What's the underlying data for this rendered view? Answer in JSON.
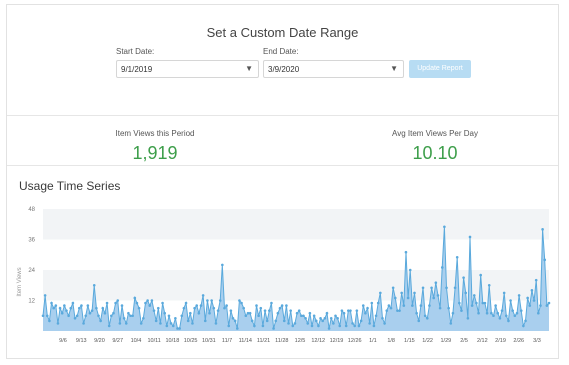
{
  "date_range": {
    "title": "Set a Custom Date Range",
    "start_label": "Start Date:",
    "start_value": "9/1/2019",
    "end_label": "End Date:",
    "end_value": "3/9/2020",
    "update_button": "Update Report",
    "caret_icon": "triangle-down"
  },
  "stats": {
    "views_label": "Item Views this Period",
    "views_value": "1,919",
    "avg_label": "Avg Item Views Per Day",
    "avg_value": "10.10",
    "value_color": "#3d9e4a"
  },
  "usage": {
    "title": "Usage Time Series"
  },
  "chart_data": {
    "type": "area",
    "ylabel": "Item Views",
    "xlabel": "",
    "ylim": [
      0,
      48
    ],
    "yticks": [
      12,
      24,
      36,
      48
    ],
    "grid": "horizontal bands",
    "color": "#5aa9dc",
    "fill": "#a9cfee",
    "xtick_labels": [
      "9/6",
      "9/13",
      "9/20",
      "9/27",
      "10/4",
      "10/11",
      "10/18",
      "10/25",
      "10/31",
      "11/7",
      "11/14",
      "11/21",
      "11/28",
      "12/5",
      "12/12",
      "12/19",
      "12/26",
      "1/1",
      "1/8",
      "1/15",
      "1/22",
      "1/29",
      "2/5",
      "2/12",
      "2/19",
      "2/26",
      "3/3"
    ],
    "values": [
      6,
      14,
      6,
      4,
      11,
      9,
      10,
      3,
      9,
      7,
      10,
      8,
      6,
      9,
      11,
      5,
      6,
      9,
      10,
      3,
      6,
      10,
      7,
      8,
      18,
      9,
      6,
      4,
      9,
      7,
      11,
      2,
      6,
      7,
      11,
      12,
      3,
      10,
      5,
      3,
      7,
      6,
      6,
      13,
      11,
      9,
      3,
      5,
      11,
      12,
      10,
      12,
      8,
      4,
      9,
      3,
      11,
      7,
      2,
      6,
      3,
      2,
      5,
      1,
      1,
      6,
      9,
      11,
      4,
      7,
      3,
      9,
      10,
      7,
      10,
      14,
      4,
      12,
      7,
      12,
      9,
      3,
      8,
      12,
      26,
      9,
      10,
      2,
      8,
      5,
      4,
      1,
      12,
      11,
      9,
      6,
      7,
      7,
      4,
      2,
      10,
      6,
      9,
      2,
      8,
      4,
      8,
      11,
      1,
      4,
      7,
      9,
      10,
      4,
      10,
      3,
      8,
      2,
      3,
      7,
      8,
      6,
      6,
      5,
      3,
      7,
      2,
      6,
      4,
      2,
      5,
      4,
      5,
      7,
      1,
      5,
      3,
      6,
      5,
      2,
      8,
      7,
      2,
      8,
      8,
      3,
      2,
      8,
      2,
      4,
      10,
      7,
      9,
      3,
      11,
      2,
      6,
      11,
      15,
      5,
      3,
      8,
      10,
      9,
      17,
      13,
      8,
      8,
      15,
      10,
      31,
      13,
      24,
      10,
      15,
      7,
      4,
      10,
      17,
      6,
      5,
      10,
      17,
      13,
      19,
      14,
      9,
      25,
      41,
      17,
      9,
      3,
      7,
      17,
      29,
      11,
      8,
      21,
      15,
      5,
      37,
      10,
      14,
      11,
      7,
      22,
      11,
      11,
      7,
      18,
      7,
      6,
      10,
      7,
      5,
      8,
      15,
      6,
      4,
      12,
      8,
      6,
      7,
      14,
      8,
      2,
      4,
      13,
      10,
      16,
      12,
      20,
      7,
      10,
      40,
      28,
      10,
      11
    ]
  }
}
